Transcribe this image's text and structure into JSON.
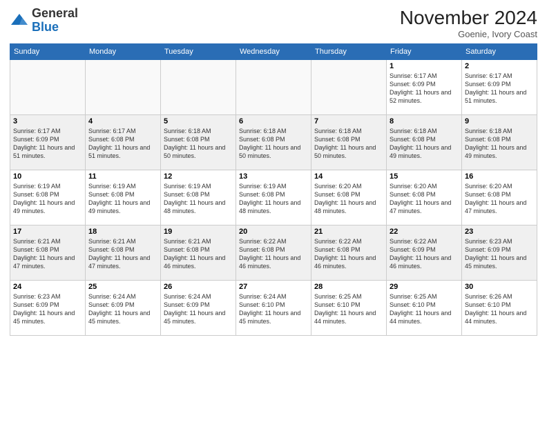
{
  "header": {
    "logo_line1": "General",
    "logo_line2": "Blue",
    "month_title": "November 2024",
    "subtitle": "Goenie, Ivory Coast"
  },
  "days_of_week": [
    "Sunday",
    "Monday",
    "Tuesday",
    "Wednesday",
    "Thursday",
    "Friday",
    "Saturday"
  ],
  "weeks": [
    [
      {
        "day": "",
        "info": ""
      },
      {
        "day": "",
        "info": ""
      },
      {
        "day": "",
        "info": ""
      },
      {
        "day": "",
        "info": ""
      },
      {
        "day": "",
        "info": ""
      },
      {
        "day": "1",
        "info": "Sunrise: 6:17 AM\nSunset: 6:09 PM\nDaylight: 11 hours and 52 minutes."
      },
      {
        "day": "2",
        "info": "Sunrise: 6:17 AM\nSunset: 6:09 PM\nDaylight: 11 hours and 51 minutes."
      }
    ],
    [
      {
        "day": "3",
        "info": "Sunrise: 6:17 AM\nSunset: 6:09 PM\nDaylight: 11 hours and 51 minutes."
      },
      {
        "day": "4",
        "info": "Sunrise: 6:17 AM\nSunset: 6:08 PM\nDaylight: 11 hours and 51 minutes."
      },
      {
        "day": "5",
        "info": "Sunrise: 6:18 AM\nSunset: 6:08 PM\nDaylight: 11 hours and 50 minutes."
      },
      {
        "day": "6",
        "info": "Sunrise: 6:18 AM\nSunset: 6:08 PM\nDaylight: 11 hours and 50 minutes."
      },
      {
        "day": "7",
        "info": "Sunrise: 6:18 AM\nSunset: 6:08 PM\nDaylight: 11 hours and 50 minutes."
      },
      {
        "day": "8",
        "info": "Sunrise: 6:18 AM\nSunset: 6:08 PM\nDaylight: 11 hours and 49 minutes."
      },
      {
        "day": "9",
        "info": "Sunrise: 6:18 AM\nSunset: 6:08 PM\nDaylight: 11 hours and 49 minutes."
      }
    ],
    [
      {
        "day": "10",
        "info": "Sunrise: 6:19 AM\nSunset: 6:08 PM\nDaylight: 11 hours and 49 minutes."
      },
      {
        "day": "11",
        "info": "Sunrise: 6:19 AM\nSunset: 6:08 PM\nDaylight: 11 hours and 49 minutes."
      },
      {
        "day": "12",
        "info": "Sunrise: 6:19 AM\nSunset: 6:08 PM\nDaylight: 11 hours and 48 minutes."
      },
      {
        "day": "13",
        "info": "Sunrise: 6:19 AM\nSunset: 6:08 PM\nDaylight: 11 hours and 48 minutes."
      },
      {
        "day": "14",
        "info": "Sunrise: 6:20 AM\nSunset: 6:08 PM\nDaylight: 11 hours and 48 minutes."
      },
      {
        "day": "15",
        "info": "Sunrise: 6:20 AM\nSunset: 6:08 PM\nDaylight: 11 hours and 47 minutes."
      },
      {
        "day": "16",
        "info": "Sunrise: 6:20 AM\nSunset: 6:08 PM\nDaylight: 11 hours and 47 minutes."
      }
    ],
    [
      {
        "day": "17",
        "info": "Sunrise: 6:21 AM\nSunset: 6:08 PM\nDaylight: 11 hours and 47 minutes."
      },
      {
        "day": "18",
        "info": "Sunrise: 6:21 AM\nSunset: 6:08 PM\nDaylight: 11 hours and 47 minutes."
      },
      {
        "day": "19",
        "info": "Sunrise: 6:21 AM\nSunset: 6:08 PM\nDaylight: 11 hours and 46 minutes."
      },
      {
        "day": "20",
        "info": "Sunrise: 6:22 AM\nSunset: 6:08 PM\nDaylight: 11 hours and 46 minutes."
      },
      {
        "day": "21",
        "info": "Sunrise: 6:22 AM\nSunset: 6:08 PM\nDaylight: 11 hours and 46 minutes."
      },
      {
        "day": "22",
        "info": "Sunrise: 6:22 AM\nSunset: 6:09 PM\nDaylight: 11 hours and 46 minutes."
      },
      {
        "day": "23",
        "info": "Sunrise: 6:23 AM\nSunset: 6:09 PM\nDaylight: 11 hours and 45 minutes."
      }
    ],
    [
      {
        "day": "24",
        "info": "Sunrise: 6:23 AM\nSunset: 6:09 PM\nDaylight: 11 hours and 45 minutes."
      },
      {
        "day": "25",
        "info": "Sunrise: 6:24 AM\nSunset: 6:09 PM\nDaylight: 11 hours and 45 minutes."
      },
      {
        "day": "26",
        "info": "Sunrise: 6:24 AM\nSunset: 6:09 PM\nDaylight: 11 hours and 45 minutes."
      },
      {
        "day": "27",
        "info": "Sunrise: 6:24 AM\nSunset: 6:10 PM\nDaylight: 11 hours and 45 minutes."
      },
      {
        "day": "28",
        "info": "Sunrise: 6:25 AM\nSunset: 6:10 PM\nDaylight: 11 hours and 44 minutes."
      },
      {
        "day": "29",
        "info": "Sunrise: 6:25 AM\nSunset: 6:10 PM\nDaylight: 11 hours and 44 minutes."
      },
      {
        "day": "30",
        "info": "Sunrise: 6:26 AM\nSunset: 6:10 PM\nDaylight: 11 hours and 44 minutes."
      }
    ]
  ]
}
